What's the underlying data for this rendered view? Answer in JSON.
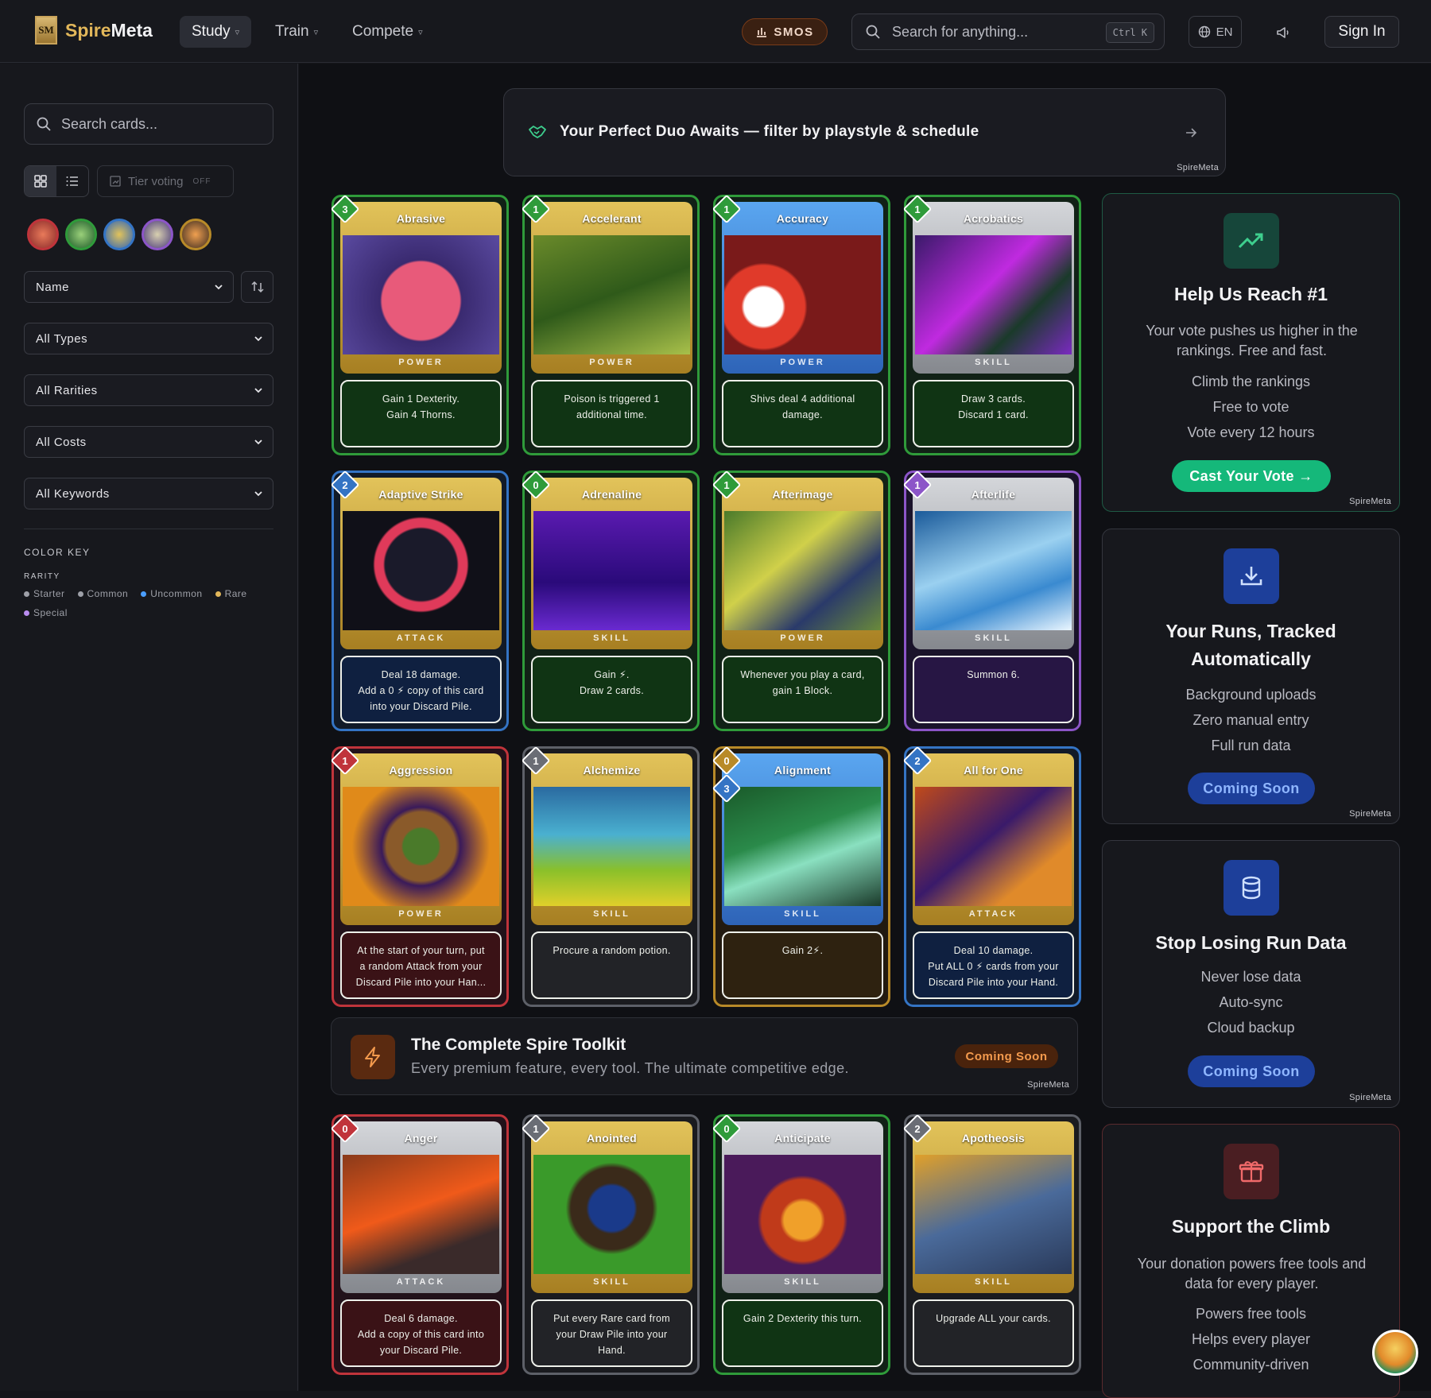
{
  "header": {
    "logo_mark": "SM",
    "logo_part1": "Spire",
    "logo_part2": "Meta",
    "nav": [
      {
        "label": "Study"
      },
      {
        "label": "Train"
      },
      {
        "label": "Compete"
      }
    ],
    "smos_label": "SMOS",
    "search_placeholder": "Search for anything...",
    "search_shortcut": "Ctrl K",
    "language": "EN",
    "signin_label": "Sign In"
  },
  "sidebar": {
    "search_placeholder": "Search cards...",
    "tier_voting_label": "Tier voting",
    "tier_voting_state": "OFF",
    "sort_select": "Name",
    "filters": [
      "All Types",
      "All Rarities",
      "All Costs",
      "All Keywords"
    ],
    "color_key_title": "COLOR KEY",
    "rarity_title": "RARITY",
    "rarities": [
      {
        "label": "Starter",
        "color": "#9ea0a8"
      },
      {
        "label": "Common",
        "color": "#9ea0a8"
      },
      {
        "label": "Uncommon",
        "color": "#4a9eff"
      },
      {
        "label": "Rare",
        "color": "#e2b75a"
      },
      {
        "label": "Special",
        "color": "#b98cf0"
      }
    ]
  },
  "duo_banner": {
    "text": "Your Perfect Duo Awaits — filter by playstyle & schedule",
    "brand": "SpireMeta"
  },
  "cards": [
    {
      "name": "Abrasive",
      "cost": "3",
      "type": "POWER",
      "desc": [
        "Gain 1 Dexterity.",
        "Gain 4 Thorns."
      ]
    },
    {
      "name": "Accelerant",
      "cost": "1",
      "type": "POWER",
      "desc": [
        "Poison is triggered 1",
        "additional time."
      ]
    },
    {
      "name": "Accuracy",
      "cost": "1",
      "type": "POWER",
      "desc": [
        "Shivs deal 4 additional",
        "damage."
      ]
    },
    {
      "name": "Acrobatics",
      "cost": "1",
      "type": "SKILL",
      "desc": [
        "Draw 3 cards.",
        "Discard 1 card."
      ]
    },
    {
      "name": "Adaptive Strike",
      "cost": "2",
      "type": "ATTACK",
      "desc": [
        "Deal 18 damage.",
        "Add a 0 ⚡ copy of this card",
        "into your Discard Pile."
      ]
    },
    {
      "name": "Adrenaline",
      "cost": "0",
      "type": "SKILL",
      "desc": [
        "Gain ⚡.",
        "Draw 2 cards."
      ]
    },
    {
      "name": "Afterimage",
      "cost": "1",
      "type": "POWER",
      "desc": [
        "Whenever you play a card,",
        "gain 1 Block."
      ]
    },
    {
      "name": "Afterlife",
      "cost": "1",
      "type": "SKILL",
      "desc": [
        "Summon 6."
      ]
    },
    {
      "name": "Aggression",
      "cost": "1",
      "type": "POWER",
      "desc": [
        "At the start of your turn, put",
        "a random Attack from your",
        "Discard Pile into your Han..."
      ]
    },
    {
      "name": "Alchemize",
      "cost": "1",
      "type": "SKILL",
      "desc": [
        "Procure a random potion."
      ]
    },
    {
      "name": "Alignment",
      "cost": "0",
      "cost2": "3",
      "type": "SKILL",
      "desc": [
        "Gain 2⚡."
      ]
    },
    {
      "name": "All for One",
      "cost": "2",
      "type": "ATTACK",
      "desc": [
        "Deal 10 damage.",
        "Put ALL 0 ⚡ cards from your",
        "Discard Pile into your Hand."
      ]
    },
    {
      "name": "Anger",
      "cost": "0",
      "type": "ATTACK",
      "desc": [
        "Deal 6 damage.",
        "Add a copy of this card into",
        "your Discard Pile."
      ]
    },
    {
      "name": "Anointed",
      "cost": "1",
      "type": "SKILL",
      "desc": [
        "Put every Rare card from",
        "your Draw Pile into your",
        "Hand."
      ]
    },
    {
      "name": "Anticipate",
      "cost": "0",
      "type": "SKILL",
      "desc": [
        "Gain 2 Dexterity this turn."
      ]
    },
    {
      "name": "Apotheosis",
      "cost": "2",
      "type": "SKILL",
      "desc": [
        "Upgrade ALL your cards."
      ]
    }
  ],
  "toolkit": {
    "title": "The Complete Spire Toolkit",
    "subtitle": "Every premium feature, every tool. The ultimate competitive edge.",
    "badge": "Coming Soon",
    "brand": "SpireMeta"
  },
  "promos": [
    {
      "title": [
        "Help Us Reach #1"
      ],
      "subtitle": [
        "Your vote pushes us higher in the",
        "rankings. Free and fast."
      ],
      "lines": [
        "Climb the rankings",
        "Free to vote",
        "Vote every 12 hours"
      ],
      "button": "Cast Your Vote →",
      "brand": "SpireMeta"
    },
    {
      "title": [
        "Your Runs, Tracked",
        "Automatically"
      ],
      "lines": [
        "Background uploads",
        "Zero manual entry",
        "Full run data"
      ],
      "button": "Coming Soon",
      "brand": "SpireMeta"
    },
    {
      "title": [
        "Stop Losing Run Data"
      ],
      "lines": [
        "Never lose data",
        "Auto-sync",
        "Cloud backup"
      ],
      "button": "Coming Soon",
      "brand": "SpireMeta"
    },
    {
      "title": [
        "Support the Climb"
      ],
      "subtitle": [
        "Your donation powers free tools and",
        "data for every player."
      ],
      "lines": [
        "Powers free tools",
        "Helps every player",
        "Community-driven"
      ]
    }
  ]
}
